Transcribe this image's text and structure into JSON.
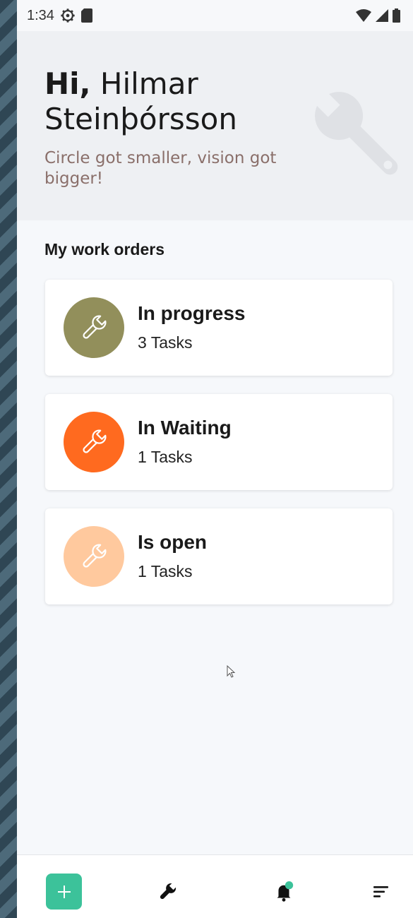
{
  "status_bar": {
    "time": "1:34"
  },
  "header": {
    "greeting_prefix": "Hi,",
    "first_name": "Hilmar",
    "last_name": "Steinþórsson",
    "tagline": "Circle got smaller, vision got bigger!"
  },
  "work_orders": {
    "section_title": "My work orders",
    "cards": [
      {
        "title": "In progress",
        "count": "3 Tasks",
        "color": "#928f5b"
      },
      {
        "title": "In Waiting",
        "count": "1 Tasks",
        "color": "#ff6a1f"
      },
      {
        "title": "Is open",
        "count": "1 Tasks",
        "color": "#ffc99e"
      }
    ]
  },
  "colors": {
    "accent": "#3cc29a",
    "notification_dot": "#3cc29a"
  },
  "bottom_nav": {
    "items": [
      {
        "icon": "plus-icon"
      },
      {
        "icon": "wrench-icon"
      },
      {
        "icon": "bell-icon"
      },
      {
        "icon": "menu-icon"
      }
    ]
  }
}
